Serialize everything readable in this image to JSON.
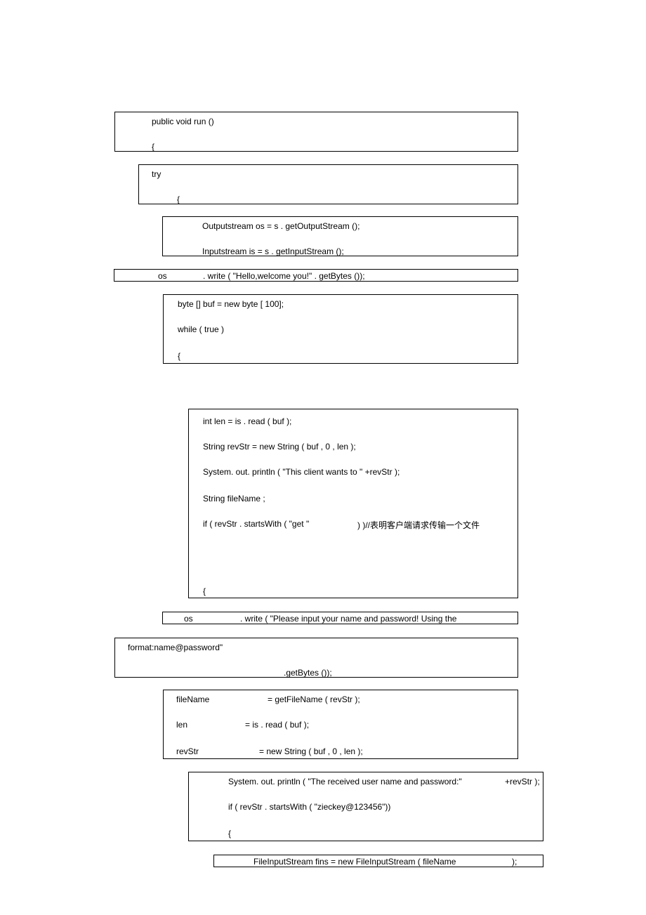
{
  "lines": {
    "l1": "public void run ()",
    "l2": "{",
    "l3": "try",
    "l4": "{",
    "l5": "Outputstream os = s . getOutputStream ();",
    "l6": "Inputstream is = s . getInputStream ();",
    "l7a": "os",
    "l7b": ". write ( \"Hello,welcome you!\" . getBytes ());",
    "l8": "byte [] buf = new byte [ 100];",
    "l9": "while ( true )",
    "l10": "{",
    "l11": "int len = is . read ( buf );",
    "l12": "String revStr = new String ( buf , 0 , len );",
    "l13": "System. out. println ( \"This client wants to \" +revStr );",
    "l14": "String fileName ;",
    "l15a": "if ( revStr . startsWith ( \"get \"",
    "l15b": ") )//表明客户端请求传输一个文件",
    "l16": "{",
    "l17a": "os",
    "l17b": ". write ( \"Please input your name and password! Using the",
    "l18": "format:name@password\"",
    "l19": ".getBytes ());",
    "l20a": "fileName",
    "l20b": "= getFileName ( revStr );",
    "l21a": "len",
    "l21b": "= is . read ( buf );",
    "l22a": "revStr",
    "l22b": "= new String ( buf , 0 , len );",
    "l23a": "System. out. println ( \"The received user name and password:\"",
    "l23b": "+revStr );",
    "l24": "if ( revStr . startsWith ( \"zieckey@123456\"))",
    "l25": "{",
    "l26a": "FileInputStream fins = new FileInputStream ( fileName",
    "l26b": ");"
  }
}
